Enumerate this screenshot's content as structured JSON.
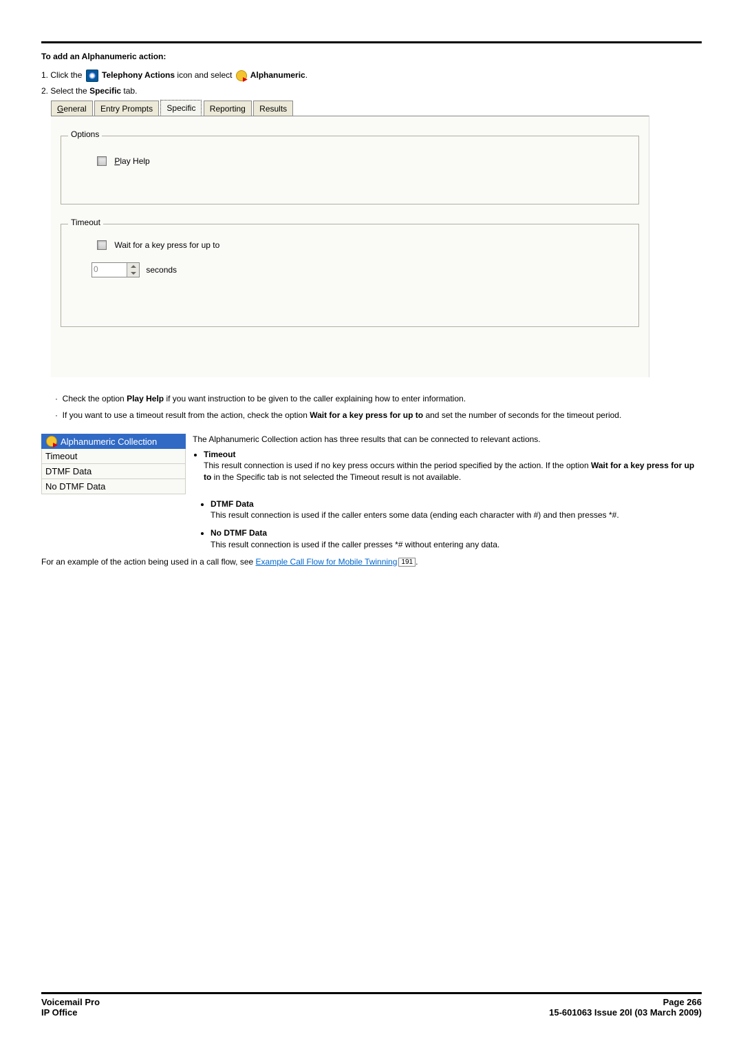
{
  "headings": {
    "addAction": "To add an Alphanumeric action:"
  },
  "step1": {
    "prefix": "1.",
    "textA": "Click the",
    "telephonyActions": " Telephony Actions",
    "textB": " icon and select",
    "alphanumeric": " Alphanumeric",
    "suffix": "."
  },
  "step2": {
    "prefix": "2.",
    "textA": "Select the ",
    "specific": "Specific",
    "textB": " tab."
  },
  "tabs": {
    "general": "General",
    "entryPrompts": "Entry Prompts",
    "specific": "Specific",
    "reporting": "Reporting",
    "results": "Results"
  },
  "specificTab": {
    "optionsLegend": "Options",
    "playHelp": "Play Help",
    "timeoutLegend": "Timeout",
    "waitLabel": "Wait for a key press for up to",
    "spinnerValue": "0",
    "secondsLabel": "seconds"
  },
  "bullets": {
    "b1a": "Check the option ",
    "b1bold": "Play Help",
    "b1b": " if you want instruction to be given to the caller explaining how to enter information.",
    "b2a": "If you want to use a timeout result from the action, check the option ",
    "b2bold": "Wait for a key press for up to",
    "b2b": " and set the number of seconds for the timeout period."
  },
  "resultsWidget": {
    "header": "Alphanumeric Collection",
    "rows": [
      "Timeout",
      "DTMF Data",
      "No DTMF Data"
    ]
  },
  "colText": {
    "intro": "The Alphanumeric Collection action has three results that can be connected to relevant actions.",
    "timeoutTitle": "Timeout",
    "timeoutBodyA": "This result connection is used if no key press occurs within the period specified by the action. If the option ",
    "timeoutBodyBold": "Wait for a key press for up to",
    "timeoutBodyB": " in the Specific tab is not selected the Timeout result is not available."
  },
  "later": {
    "dtmfTitle": "DTMF Data",
    "dtmfBody": "This result connection is used if the caller enters some data (ending each character with #) and then presses *#.",
    "noDtmfTitle": "No DTMF Data",
    "noDtmfBody": "This result connection is used if the caller presses *# without entering any data."
  },
  "example": {
    "prefix": "For an example of the action being used in a call flow, see ",
    "linkText": "Example Call Flow for Mobile Twinning",
    "refNum": "191",
    "suffix": "."
  },
  "footer": {
    "l1": "Voicemail Pro",
    "r1": "Page 266",
    "l2": "IP Office",
    "r2": "15-601063 Issue 20l (03 March 2009)"
  }
}
